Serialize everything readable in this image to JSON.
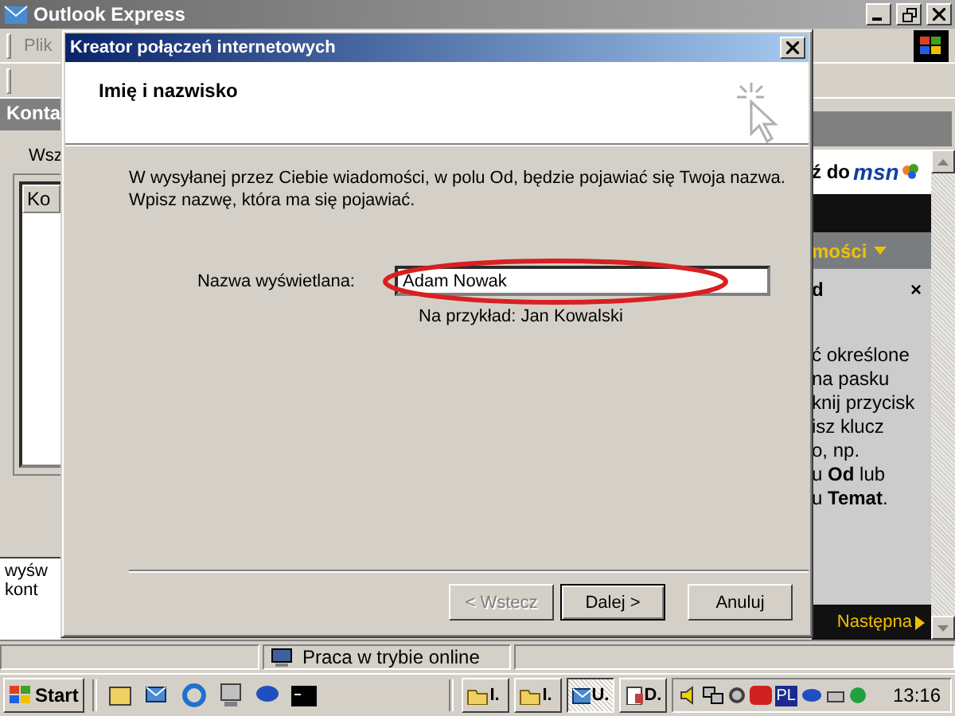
{
  "background_window": {
    "title": "Outlook Express",
    "menu": [
      "Plik"
    ],
    "panel_title": "Konta",
    "tab_label": "Wsz",
    "column_header": "Ko",
    "footer_lines": [
      "wyśw",
      "kont"
    ]
  },
  "msn_pane": {
    "heading": "ź do",
    "logo": "msn",
    "menu": "mości",
    "section": "d",
    "close": "×",
    "lines": [
      "ć określone",
      "na pasku",
      "knij przycisk",
      "isz klucz",
      "o, np.",
      "u **Od** lub",
      "u **Temat**."
    ],
    "next": "Następna"
  },
  "dialog": {
    "title": "Kreator połączeń internetowych",
    "heading": "Imię i nazwisko",
    "intro": [
      "W wysyłanej przez Ciebie wiadomości, w polu Od, będzie pojawiać się Twoja nazwa.",
      "Wpisz nazwę, która ma się pojawiać."
    ],
    "field_label": "Nazwa wyświetlana:",
    "field_value": "Adam Nowak",
    "example": "Na przykład: Jan Kowalski",
    "buttons": [
      {
        "label": "< Wstecz",
        "disabled": true,
        "default": false
      },
      {
        "label": "Dalej >",
        "disabled": false,
        "default": true
      },
      {
        "label": "Anuluj",
        "disabled": false,
        "default": false
      }
    ]
  },
  "status_bar": {
    "text": "Praca w trybie online"
  },
  "taskbar": {
    "start": "Start",
    "tasks": [
      {
        "label": "I.",
        "kind": "folder",
        "selected": false
      },
      {
        "label": "I.",
        "kind": "folder",
        "selected": false
      },
      {
        "label": "U.",
        "kind": "mail",
        "selected": true
      },
      {
        "label": "D.",
        "kind": "doc",
        "selected": false
      }
    ],
    "language": "PL",
    "clock": "13:16"
  }
}
